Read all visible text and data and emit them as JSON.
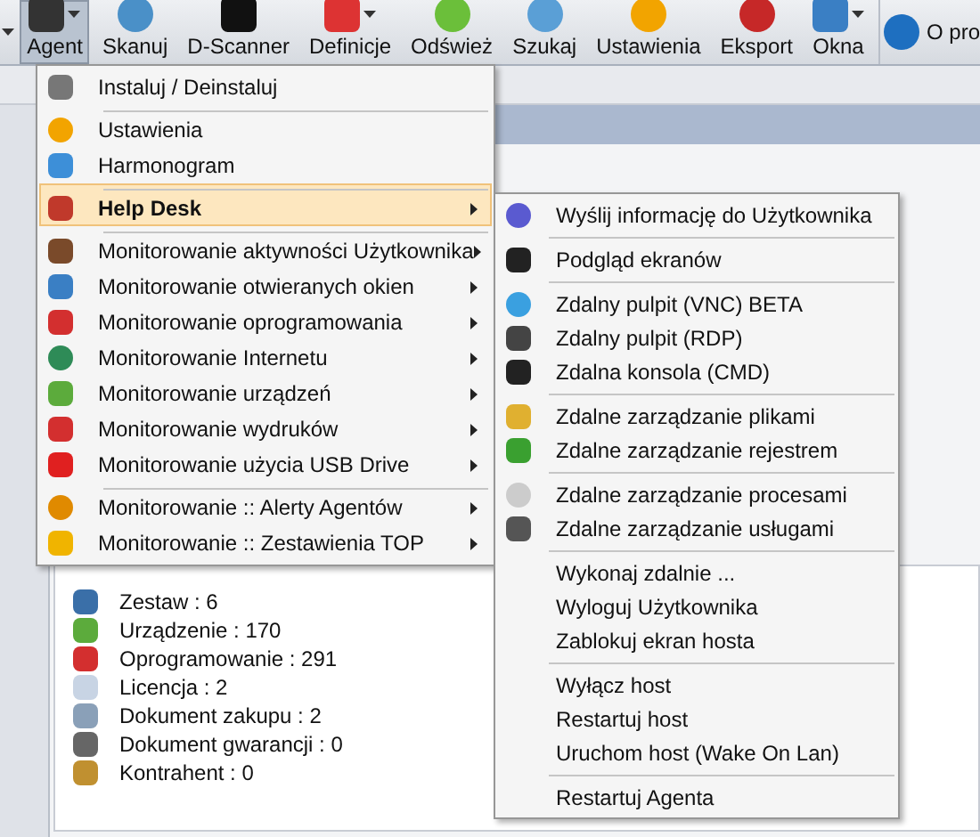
{
  "toolbar": {
    "buttons": [
      {
        "label": "Agent",
        "dropdown": true,
        "selected": true
      },
      {
        "label": "Skanuj",
        "dropdown": false,
        "selected": false
      },
      {
        "label": "D-Scanner",
        "dropdown": false,
        "selected": false
      },
      {
        "label": "Definicje",
        "dropdown": true,
        "selected": false
      },
      {
        "label": "Odśwież",
        "dropdown": false,
        "selected": false
      },
      {
        "label": "Szukaj",
        "dropdown": false,
        "selected": false
      },
      {
        "label": "Ustawienia",
        "dropdown": false,
        "selected": false
      },
      {
        "label": "Eksport",
        "dropdown": false,
        "selected": false
      },
      {
        "label": "Okna",
        "dropdown": true,
        "selected": false
      }
    ],
    "about": {
      "label": "O pro"
    }
  },
  "stats": [
    {
      "label": "Zestaw : 6"
    },
    {
      "label": "Urządzenie : 170"
    },
    {
      "label": "Oprogramowanie : 291"
    },
    {
      "label": "Licencja : 2"
    },
    {
      "label": "Dokument zakupu : 2"
    },
    {
      "label": "Dokument gwarancji : 0"
    },
    {
      "label": "Kontrahent : 0"
    }
  ],
  "agent_menu": {
    "items": [
      {
        "label": "Instaluj / Deinstaluj",
        "separator_before": false,
        "submenu": false,
        "selected": false
      },
      {
        "label": "Ustawienia",
        "separator_before": true,
        "submenu": false,
        "selected": false
      },
      {
        "label": "Harmonogram",
        "separator_before": false,
        "submenu": false,
        "selected": false
      },
      {
        "label": "Help Desk",
        "separator_before": true,
        "submenu": true,
        "selected": true
      },
      {
        "label": "Monitorowanie aktywności Użytkownika",
        "separator_before": true,
        "submenu": true,
        "selected": false
      },
      {
        "label": "Monitorowanie otwieranych okien",
        "separator_before": false,
        "submenu": true,
        "selected": false
      },
      {
        "label": "Monitorowanie oprogramowania",
        "separator_before": false,
        "submenu": true,
        "selected": false
      },
      {
        "label": "Monitorowanie Internetu",
        "separator_before": false,
        "submenu": true,
        "selected": false
      },
      {
        "label": "Monitorowanie urządzeń",
        "separator_before": false,
        "submenu": true,
        "selected": false
      },
      {
        "label": "Monitorowanie wydruków",
        "separator_before": false,
        "submenu": true,
        "selected": false
      },
      {
        "label": "Monitorowanie użycia USB Drive",
        "separator_before": false,
        "submenu": true,
        "selected": false
      },
      {
        "label": "Monitorowanie :: Alerty Agentów",
        "separator_before": true,
        "submenu": true,
        "selected": false
      },
      {
        "label": "Monitorowanie :: Zestawienia TOP",
        "separator_before": false,
        "submenu": true,
        "selected": false
      }
    ]
  },
  "helpdesk_menu": {
    "items": [
      {
        "label": "Wyślij informację do Użytkownika",
        "separator_before": false
      },
      {
        "label": "Podgląd ekranów",
        "separator_before": true
      },
      {
        "label": "Zdalny pulpit (VNC) BETA",
        "separator_before": true
      },
      {
        "label": "Zdalny pulpit (RDP)",
        "separator_before": false
      },
      {
        "label": "Zdalna konsola (CMD)",
        "separator_before": false
      },
      {
        "label": "Zdalne zarządzanie plikami",
        "separator_before": true
      },
      {
        "label": "Zdalne zarządzanie rejestrem",
        "separator_before": false
      },
      {
        "label": "Zdalne zarządzanie procesami",
        "separator_before": true
      },
      {
        "label": "Zdalne zarządzanie usługami",
        "separator_before": false
      },
      {
        "label": "Wykonaj zdalnie ...",
        "separator_before": true
      },
      {
        "label": "Wyloguj Użytkownika",
        "separator_before": false
      },
      {
        "label": "Zablokuj ekran hosta",
        "separator_before": false
      },
      {
        "label": "Wyłącz host",
        "separator_before": true
      },
      {
        "label": "Restartuj host",
        "separator_before": false
      },
      {
        "label": "Uruchom host (Wake On Lan)",
        "separator_before": false
      },
      {
        "label": "Restartuj Agenta",
        "separator_before": true
      }
    ]
  }
}
